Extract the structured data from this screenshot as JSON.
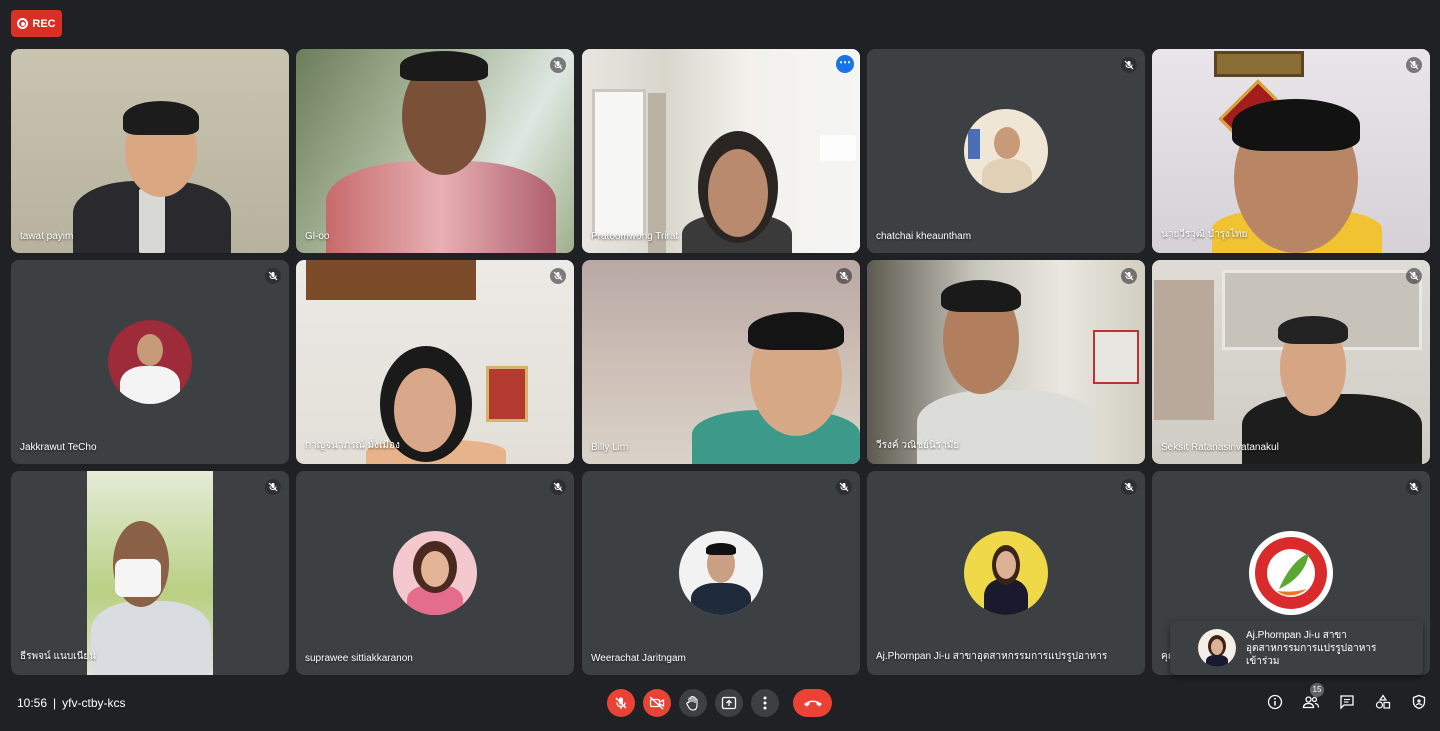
{
  "recording": {
    "label": "REC"
  },
  "meeting": {
    "time": "10:56",
    "separator": "|",
    "code": "yfv-ctby-kcs"
  },
  "participants": [
    {
      "name": "tawat payim",
      "muted": false
    },
    {
      "name": "Gl-oo",
      "muted": true
    },
    {
      "name": "Pratoomwong Trirat",
      "muted": false,
      "active": true
    },
    {
      "name": "chatchai kheauntham",
      "muted": true
    },
    {
      "name": "นายวีรวุฒิ บำรุงไทย",
      "muted": true
    },
    {
      "name": "Jakkrawut TeCho",
      "muted": true
    },
    {
      "name": "กาญจนาภรณ์ มั่งเมือง",
      "muted": true
    },
    {
      "name": "Billy Lim",
      "muted": true
    },
    {
      "name": "วีรงค์ วณิชย์นิรามัย",
      "muted": true
    },
    {
      "name": "Seksit Ratanasirivatanakul",
      "muted": true
    },
    {
      "name": "ธีรพจน์ แนบเนียน",
      "muted": true
    },
    {
      "name": "suprawee sittiakkaranon",
      "muted": true
    },
    {
      "name": "Weerachat Jaritngam",
      "muted": true
    },
    {
      "name": "Aj.Phornpan Ji-u สาขาอุตสาหกรรมการแปรรูปอาหาร",
      "muted": true
    },
    {
      "name": "คุณ",
      "muted": true
    }
  ],
  "notification": {
    "line1": "Aj.Phornpan Ji-u สาขา",
    "line2": "อุตสาหกรรมการแปรรูปอาหาร",
    "line3": "เข้าร่วม"
  },
  "participant_count": "15",
  "colors": {
    "end_call": "#ea4335",
    "active_border": "#8ab4f8",
    "tile_bg": "#3c4043"
  }
}
